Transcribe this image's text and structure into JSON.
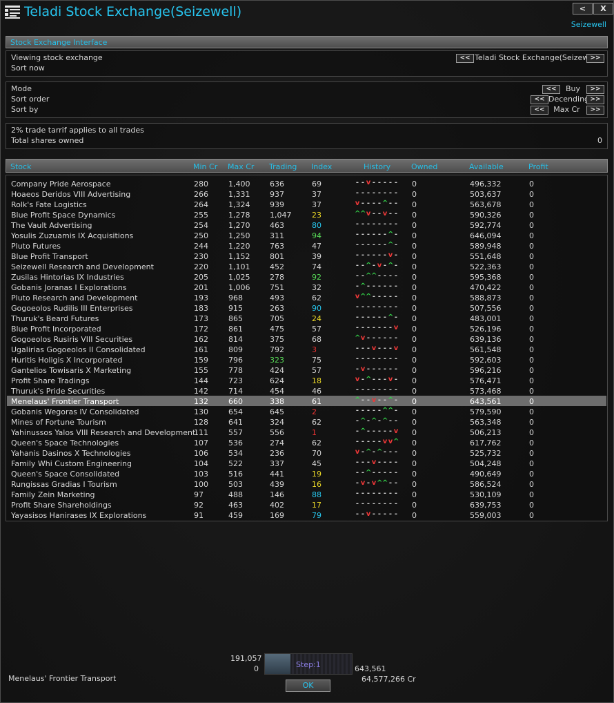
{
  "window": {
    "title": "Teladi Stock Exchange(Seizewell)",
    "station": "Seizewell",
    "prev_glyph": "<",
    "close_glyph": "X",
    "icon": "grid-document-icon"
  },
  "interface_bar": {
    "label": "Stock Exchange Interface"
  },
  "viewing": {
    "label": "Viewing stock exchange",
    "value": "Teladi Stock Exchange(Seizewell)",
    "sort_now": "Sort now"
  },
  "options": {
    "mode_label": "Mode",
    "mode_value": "Buy",
    "sort_order_label": "Sort order",
    "sort_order_value": "Decending",
    "sort_by_label": "Sort by",
    "sort_by_value": "Max Cr",
    "prev_glyph": "<<",
    "next_glyph": ">>"
  },
  "info": {
    "tariff": "2% trade tarrif applies to all trades",
    "total_label": "Total shares owned",
    "total_value": "0"
  },
  "table": {
    "headers": {
      "stock": "Stock",
      "min": "Min Cr",
      "max": "Max Cr",
      "trading": "Trading",
      "index": "Index",
      "history": "History",
      "owned": "Owned",
      "available": "Available",
      "profit": "Profit"
    },
    "index_colors": {
      "default": "#d7d7d7",
      "cyan": "#27c7ee",
      "green": "#57d957",
      "yellow": "#ecd927",
      "red": "#ee3434"
    },
    "rows": [
      {
        "name": "Company Pride Aerospace",
        "min": "280",
        "max": "1,400",
        "trading": "636",
        "index": "69",
        "history": "--v-----",
        "owned": "0",
        "available": "496,332",
        "profit": "0"
      },
      {
        "name": "Hoaeos Deridos VIII Advertising",
        "min": "266",
        "max": "1,331",
        "trading": "937",
        "index": "37",
        "history": "--------",
        "owned": "0",
        "available": "503,637",
        "profit": "0"
      },
      {
        "name": "Rolk's Fate Logistics",
        "min": "264",
        "max": "1,324",
        "trading": "939",
        "index": "37",
        "history": "v----^--",
        "owned": "0",
        "available": "563,678",
        "profit": "0"
      },
      {
        "name": "Blue Profit Space Dynamics",
        "min": "255",
        "max": "1,278",
        "trading": "1,047",
        "index": "23",
        "index_color": "yellow",
        "history": "^^v--v--",
        "owned": "0",
        "available": "590,326",
        "profit": "0"
      },
      {
        "name": "The Vault Advertising",
        "min": "254",
        "max": "1,270",
        "trading": "463",
        "index": "80",
        "index_color": "cyan",
        "history": "--------",
        "owned": "0",
        "available": "592,774",
        "profit": "0"
      },
      {
        "name": "Yosulis Zuzuamis IX Acquisitions",
        "min": "250",
        "max": "1,250",
        "trading": "311",
        "index": "94",
        "index_color": "green",
        "history": "------^-",
        "owned": "0",
        "available": "646,094",
        "profit": "0"
      },
      {
        "name": "Pluto Futures",
        "min": "244",
        "max": "1,220",
        "trading": "763",
        "index": "47",
        "history": "------^-",
        "owned": "0",
        "available": "589,948",
        "profit": "0"
      },
      {
        "name": "Blue Profit Transport",
        "min": "230",
        "max": "1,152",
        "trading": "801",
        "index": "39",
        "history": "------v-",
        "owned": "0",
        "available": "551,648",
        "profit": "0"
      },
      {
        "name": "Seizewell Research and Development",
        "min": "220",
        "max": "1,101",
        "trading": "452",
        "index": "74",
        "history": "--^-v-^-",
        "owned": "0",
        "available": "522,363",
        "profit": "0"
      },
      {
        "name": "Zusilas Hintorias IX Industries",
        "min": "205",
        "max": "1,025",
        "trading": "278",
        "index": "92",
        "index_color": "green",
        "history": "--^^----",
        "owned": "0",
        "available": "595,368",
        "profit": "0"
      },
      {
        "name": "Gobanis Joranas I Explorations",
        "min": "201",
        "max": "1,006",
        "trading": "751",
        "index": "32",
        "history": "-^------",
        "owned": "0",
        "available": "470,422",
        "profit": "0"
      },
      {
        "name": "Pluto Research and Development",
        "min": "193",
        "max": "968",
        "trading": "493",
        "index": "62",
        "history": "v^^-----",
        "owned": "0",
        "available": "588,873",
        "profit": "0"
      },
      {
        "name": "Gogoeolos Rudilis III Enterprises",
        "min": "183",
        "max": "915",
        "trading": "263",
        "index": "90",
        "index_color": "cyan",
        "history": "--------",
        "owned": "0",
        "available": "507,556",
        "profit": "0"
      },
      {
        "name": "Thuruk's Beard Futures",
        "min": "173",
        "max": "865",
        "trading": "705",
        "index": "24",
        "index_color": "yellow",
        "history": "------^-",
        "owned": "0",
        "available": "483,001",
        "profit": "0"
      },
      {
        "name": "Blue Profit Incorporated",
        "min": "172",
        "max": "861",
        "trading": "475",
        "index": "57",
        "history": "-------v",
        "owned": "0",
        "available": "526,196",
        "profit": "0"
      },
      {
        "name": "Gogoeolos Rusiris VIII Securities",
        "min": "162",
        "max": "814",
        "trading": "375",
        "index": "68",
        "history": "^v------",
        "owned": "0",
        "available": "639,136",
        "profit": "0"
      },
      {
        "name": "Ugalirias Gogoeolos II Consolidated",
        "min": "161",
        "max": "809",
        "trading": "792",
        "index": "3",
        "index_color": "red",
        "history": "---v---v",
        "owned": "0",
        "available": "561,548",
        "profit": "0"
      },
      {
        "name": "Huritis Holigis X Incorporated",
        "min": "159",
        "max": "796",
        "trading": "323",
        "trading_color": "green",
        "index": "75",
        "history": "--------",
        "owned": "0",
        "available": "592,603",
        "profit": "0"
      },
      {
        "name": "Gantelios Towisaris X Marketing",
        "min": "155",
        "max": "778",
        "trading": "424",
        "index": "57",
        "history": "-v------",
        "owned": "0",
        "available": "596,216",
        "profit": "0"
      },
      {
        "name": "Profit Share Tradings",
        "min": "144",
        "max": "723",
        "trading": "624",
        "index": "18",
        "index_color": "yellow",
        "history": "v-^---v-",
        "owned": "0",
        "available": "576,471",
        "profit": "0"
      },
      {
        "name": "Thuruk's Pride Securities",
        "min": "142",
        "max": "714",
        "trading": "454",
        "index": "46",
        "history": "--------",
        "owned": "0",
        "available": "573,468",
        "profit": "0"
      },
      {
        "name": "Menelaus' Frontier Transport",
        "min": "132",
        "max": "660",
        "trading": "338",
        "index": "61",
        "history": "^--v--^-",
        "owned": "0",
        "available": "643,561",
        "profit": "0",
        "selected": true
      },
      {
        "name": "Gobanis Wegoras IV Consolidated",
        "min": "130",
        "max": "654",
        "trading": "645",
        "index": "2",
        "index_color": "red",
        "history": "-----^^-",
        "owned": "0",
        "available": "579,590",
        "profit": "0"
      },
      {
        "name": "Mines of Fortune Tourism",
        "min": "128",
        "max": "641",
        "trading": "324",
        "index": "62",
        "history": "-^-^-^--",
        "owned": "0",
        "available": "563,348",
        "profit": "0"
      },
      {
        "name": "Yahinussos Yalos VIII Research and Development",
        "min": "111",
        "max": "557",
        "trading": "556",
        "index": "1",
        "index_color": "red",
        "history": "-^-----v",
        "owned": "0",
        "available": "506,213",
        "profit": "0"
      },
      {
        "name": "Queen's Space Technologies",
        "min": "107",
        "max": "536",
        "trading": "274",
        "index": "62",
        "history": "-----vv^",
        "owned": "0",
        "available": "617,762",
        "profit": "0"
      },
      {
        "name": "Yahanis Dasinos X Technologies",
        "min": "106",
        "max": "534",
        "trading": "236",
        "index": "70",
        "history": "v-^-^---",
        "owned": "0",
        "available": "525,732",
        "profit": "0"
      },
      {
        "name": "Family Whi Custom Engineering",
        "min": "104",
        "max": "522",
        "trading": "337",
        "index": "45",
        "history": "---v----",
        "owned": "0",
        "available": "504,248",
        "profit": "0"
      },
      {
        "name": "Queen's Space Consolidated",
        "min": "103",
        "max": "516",
        "trading": "441",
        "index": "19",
        "index_color": "yellow",
        "history": "--^-----",
        "owned": "0",
        "available": "490,649",
        "profit": "0"
      },
      {
        "name": "Rungissas Gradias I Tourism",
        "min": "100",
        "max": "503",
        "trading": "439",
        "index": "16",
        "index_color": "yellow",
        "history": "-v-v^^--",
        "owned": "0",
        "available": "586,524",
        "profit": "0"
      },
      {
        "name": "Family Zein Marketing",
        "min": "97",
        "max": "488",
        "trading": "146",
        "index": "88",
        "index_color": "cyan",
        "history": "--------",
        "owned": "0",
        "available": "530,109",
        "profit": "0"
      },
      {
        "name": "Profit Share Shareholdings",
        "min": "92",
        "max": "463",
        "trading": "402",
        "index": "17",
        "index_color": "yellow",
        "history": "--------",
        "owned": "0",
        "available": "639,753",
        "profit": "0"
      },
      {
        "name": "Yayasisos Hanirases IX Explorations",
        "min": "91",
        "max": "459",
        "trading": "169",
        "index": "79",
        "index_color": "cyan",
        "history": "--v-----",
        "owned": "0",
        "available": "559,003",
        "profit": "0"
      }
    ]
  },
  "footer": {
    "selected_stock": "Menelaus' Frontier Transport",
    "top_value": "191,057",
    "min_value": "0",
    "max_value": "643,561",
    "step_label": "Step:1",
    "step_fraction": 0.29,
    "credits": "64,577,266 Cr",
    "ok_label": "OK"
  }
}
